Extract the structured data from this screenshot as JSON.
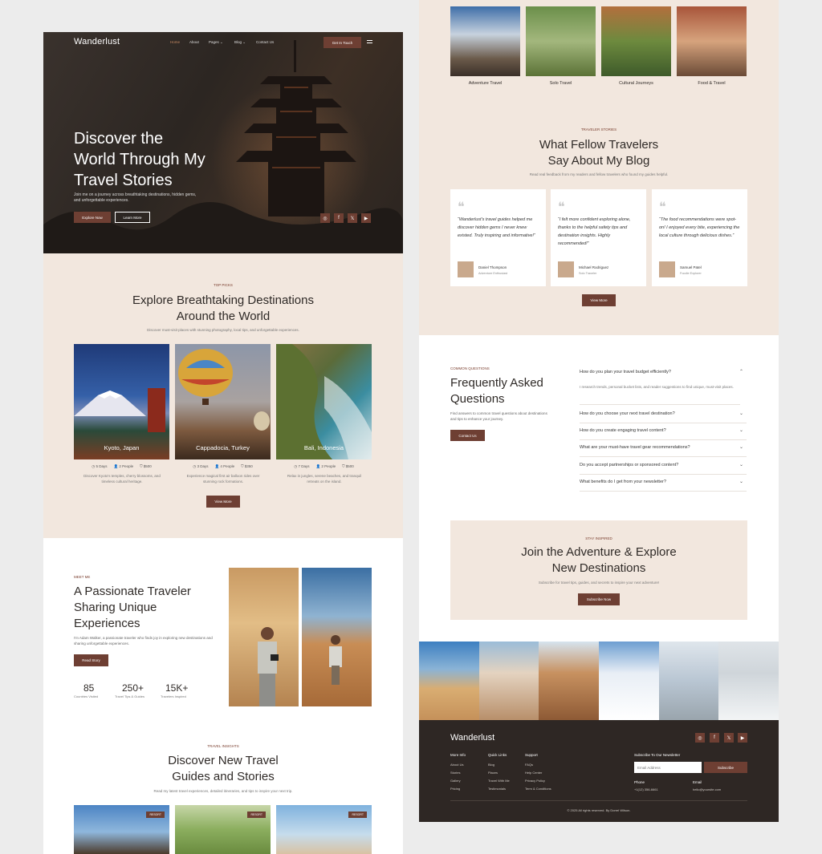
{
  "brand": {
    "name": "Wanderlust",
    "accent": "#6e3f33",
    "beige": "#f2e7de",
    "dark": "#2e2724"
  },
  "nav": {
    "items": [
      "Home",
      "About",
      "Pages",
      "Blog",
      "Contact Us"
    ],
    "cta": "Get In Touch"
  },
  "hero": {
    "title_lines": [
      "Discover the",
      "World Through My",
      "Travel Stories"
    ],
    "text": "Join me on a journey across breathtaking destinations, hidden gems, and unforgettable experiences.",
    "primary": "Explore Now",
    "secondary": "Learn More",
    "socials": [
      "instagram-icon",
      "facebook-icon",
      "x-icon",
      "youtube-icon"
    ]
  },
  "destinations": {
    "eyebrow": "TOP PICKS",
    "title_lines": [
      "Explore Breathtaking Destinations",
      "Around the World"
    ],
    "subtitle": "Discover must-visit places with stunning photography, local tips, and unforgettable experiences.",
    "cards": [
      {
        "name": "Kyoto, Japan",
        "days": "5 Days",
        "people": "2 People",
        "price": "$500",
        "desc": "Discover Kyoto's temples, cherry blossoms, and timeless cultural heritage."
      },
      {
        "name": "Cappadocia, Turkey",
        "days": "3 Days",
        "people": "4 People",
        "price": "$350",
        "desc": "Experience magical first air balloon rides over stunning rock formations."
      },
      {
        "name": "Bali, Indonesia",
        "days": "7 Days",
        "people": "2 People",
        "price": "$500",
        "desc": "Relax in jungles, serene beaches, and tranquil retreats on the island."
      }
    ],
    "button": "View More"
  },
  "about": {
    "eyebrow": "MEET ME",
    "title_lines": [
      "A Passionate Traveler",
      "Sharing Unique",
      "Experiences"
    ],
    "text": "I'm Adam Walker, a passionate traveler who finds joy in exploring new destinations and sharing unforgettable experiences.",
    "button": "Read Story",
    "stats": [
      {
        "num": "85",
        "label": "Countries Visited"
      },
      {
        "num": "250+",
        "label": "Travel Tips & Guides"
      },
      {
        "num": "15K+",
        "label": "Travelers Inspired"
      }
    ]
  },
  "insights": {
    "eyebrow": "TRAVEL INSIGHTS",
    "title_lines": [
      "Discover New Travel",
      "Guides and Stories"
    ],
    "subtitle": "Read my latest travel experiences, detailed itineraries, and tips to inspire your next trip.",
    "tag": "RESORT"
  },
  "categories": [
    "Adventure Travel",
    "Solo Travel",
    "Cultural Journeys",
    "Food & Travel"
  ],
  "testimonials": {
    "eyebrow": "TRAVELER STORIES",
    "title_lines": [
      "What Fellow Travelers",
      "Say About My Blog"
    ],
    "subtitle": "Read real feedback from my readers and fellow travelers who found my guides helpful.",
    "items": [
      {
        "quote": "“Wanderlust's travel guides helped me discover hidden gems I never knew existed. Truly inspiring and informative!”",
        "name": "Daniel Thompson",
        "role": "Adventure Enthusiast"
      },
      {
        "quote": "“I felt more confident exploring alone, thanks to the helpful safety tips and destination insights. Highly recommended!”",
        "name": "Michael Rodriguez",
        "role": "Solo Traveler"
      },
      {
        "quote": "“The food recommendations were spot-on! I enjoyed every bite, experiencing the local culture through delicious dishes.”",
        "name": "Samuel Patel",
        "role": "Foodie Explorer"
      }
    ],
    "button": "View More"
  },
  "faq": {
    "eyebrow": "COMMON QUESTIONS",
    "title_lines": [
      "Frequently Asked",
      "Questions"
    ],
    "text": "Find answers to common travel questions about destinations and tips to enhance your journey.",
    "button": "Contact Us",
    "open_answer": "I research trends, personal bucket lists, and reader suggestions to find unique, must-visit places.",
    "questions": [
      "How do you plan your travel budget efficiently?",
      "How do you choose your next travel destination?",
      "How do you create engaging travel content?",
      "What are your must-have travel gear recommendations?",
      "Do you accept partnerships or sponsored content?",
      "What benefits do I get from your newsletter?"
    ]
  },
  "newsletter": {
    "eyebrow": "STAY INSPIRED",
    "title_lines": [
      "Join the Adventure & Explore",
      "New Destinations"
    ],
    "text": "Subscribe for travel tips, guides, and secrets to inspire your next adventure!",
    "button": "Subscribe Now"
  },
  "footer": {
    "brand": "Wanderlust",
    "cols": [
      {
        "title": "More Info",
        "links": [
          "About Us",
          "Stories",
          "Gallery",
          "Pricing"
        ]
      },
      {
        "title": "Quick Links",
        "links": [
          "Blog",
          "Places",
          "Travel With Me",
          "Testimonials"
        ]
      },
      {
        "title": "Support",
        "links": [
          "FAQs",
          "Help Center",
          "Privacy Policy",
          "Term & Conditions"
        ]
      }
    ],
    "subscribe_title": "Subscribe To Our Newsletter",
    "email_placeholder": "Email Address",
    "subscribe_btn": "Subscribe",
    "phone_label": "Phone",
    "phone": "+1(12) 356-6661",
    "email_label": "Email",
    "email": "hello@yoursite.com",
    "copyright": "© 2025 All rights reserved. By Dorrel Wilson."
  }
}
